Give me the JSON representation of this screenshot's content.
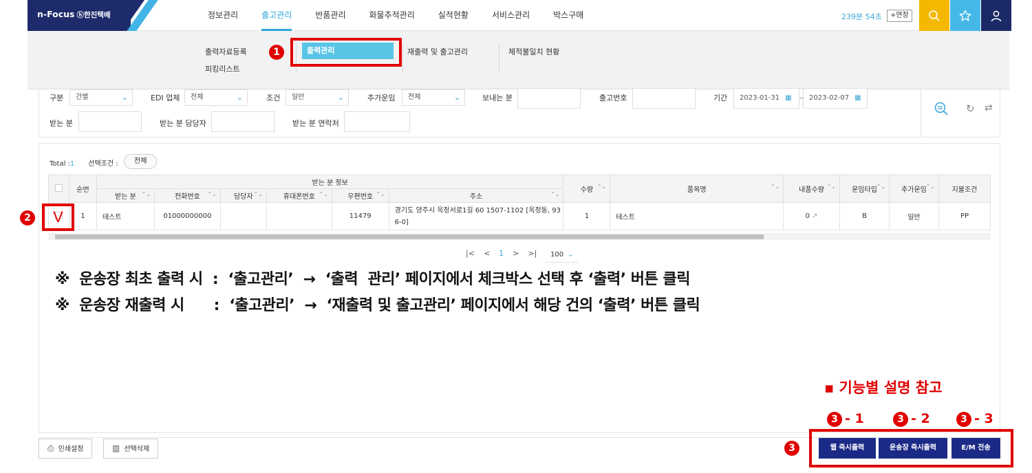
{
  "header": {
    "logo": "n-Focus",
    "logo_sub": "ⓗ한진택배",
    "nav": [
      "정보관리",
      "출고관리",
      "반품관리",
      "화물추적관리",
      "실적현황",
      "서비스관리",
      "박스구매"
    ],
    "active_nav": "출고관리",
    "session_time": "239분 54초",
    "extend_label": "+연장",
    "icons": [
      "search-icon",
      "star-icon",
      "user-icon"
    ],
    "accent_color": "#2aa6d8"
  },
  "submenu": {
    "col1": [
      "출력자료등록",
      "피킹리스트"
    ],
    "active": "출력관리",
    "col3": "재출력 및 출고관리",
    "col4": "체적불일치 현황"
  },
  "markers": {
    "m1": "1",
    "m2": "2",
    "m3": "3"
  },
  "filters": {
    "gubun_label": "구분",
    "gubun_value": "건별",
    "edi_label": "EDI 업체",
    "edi_value": "전체",
    "cond_label": "조건",
    "cond_value": "일반",
    "extra_label": "추가운임",
    "extra_value": "전체",
    "sender_label": "보내는 분",
    "ship_no_label": "출고번호",
    "period_label": "기간",
    "date_from": "2023-01-31",
    "date_sep": "~",
    "date_to": "2023-02-07",
    "receiver_label": "받는 분",
    "receiver_contact_label": "받는 분 담당자",
    "receiver_phone_label": "받는 분 연락처"
  },
  "result": {
    "total_label": "Total :",
    "total_value": "1",
    "cond_label": "선택조건 :",
    "cond_value": "전체",
    "group_header": "받는 분 정보",
    "columns": {
      "seq": "순번",
      "name": "받는 분",
      "phone": "전화번호",
      "contact": "담당자",
      "mobile": "휴대폰번호",
      "zip": "우편번호",
      "addr": "주소",
      "qty": "수량",
      "item": "품목명",
      "inner_qty": "내품수량",
      "fare_type": "운임타입",
      "extra_fare": "추가운임",
      "pay_cond": "지불조건"
    },
    "rows": [
      {
        "seq": "1",
        "name": "테스트",
        "phone": "01000000000",
        "contact": "",
        "mobile": "",
        "zip": "11479",
        "addr": "경기도 양주시 옥정서로1길 60 1507-1102 [옥정동, 93 6-0]",
        "qty": "1",
        "item": "테스트",
        "inner_qty": "0",
        "fare_type": "B",
        "extra_fare": "일반",
        "pay_cond": "PP"
      }
    ],
    "pager": {
      "current": "1",
      "page_size": "100"
    },
    "check_mark": "V"
  },
  "notes": {
    "line1": "※  운송장 최초 출력 시  :  ‘출고관리’  →  ‘출력  관리’ 페이지에서 체크박스 선택 후 ‘출력’ 버튼 클릭",
    "line2": "※  운송장 재출력 시      :  ‘출고관리’  →  ‘재출력 및 출고관리’ 페이지에서 해당 건의 ‘출력’ 버튼 클릭"
  },
  "legend": {
    "title": "▪  기능별 설명 참고",
    "sub1": "- 1",
    "sub2": "- 2",
    "sub3": "- 3"
  },
  "bottom": {
    "print_setting": "인쇄설정",
    "delete_selected": "선택삭제",
    "web_print": "웹 즉시출력",
    "waybill_print": "운송장 즉시출력",
    "em_send": "E/M 전송"
  }
}
